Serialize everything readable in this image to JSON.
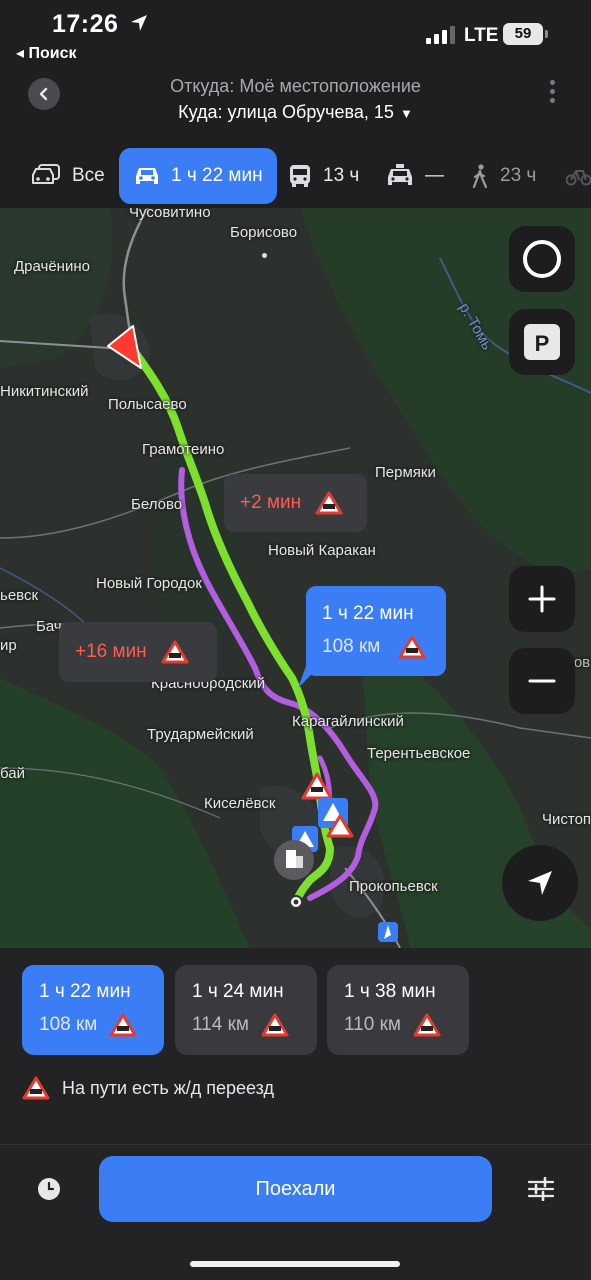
{
  "status_bar": {
    "time": "17:26",
    "back_app": "◂ Поиск",
    "network": "LTE",
    "battery": "59"
  },
  "header": {
    "from": "Откуда: Моё местоположение",
    "to": "Куда: улица Обручева, 15"
  },
  "modes": [
    {
      "label": "Все",
      "icon": "all-transport-icon"
    },
    {
      "label": "1 ч 22 мин",
      "icon": "car-icon",
      "active": true
    },
    {
      "label": "13 ч",
      "icon": "bus-icon"
    },
    {
      "label": "—",
      "icon": "taxi-icon"
    },
    {
      "label": "23 ч",
      "icon": "pedestrian-icon"
    }
  ],
  "map": {
    "places": {
      "chusovitino": "Чусовитино",
      "borisovo": "Борисово",
      "drachenino": "Драчёнино",
      "tom_river": "р. Томь",
      "nikitinsky": "Никитинский",
      "polysaevo": "Полысаево",
      "gramoteino": "Грамотеино",
      "permyaki": "Пермяки",
      "belovo": "Белово",
      "novy_karakan": "Новый Каракан",
      "novy_gorodok": "Новый Городок",
      "pevsk": "ьевск",
      "bach": "Бач",
      "ir": "ир",
      "osinov": "Осинов",
      "krasnobrodsky": "Краснобродский",
      "trudarmeysky": "Трудармейский",
      "karagaylinsky": "Карагайлинский",
      "terentievskoe": "Терентьевское",
      "bai": "бай",
      "kiselevsk": "Киселёвск",
      "chistop": "Чистоп",
      "prokopievsk": "Прокопьевск"
    },
    "bubbles": {
      "alt1_delay": "+2 мин",
      "alt2_delay": "+16 мин",
      "main_time": "1 ч 22 мин",
      "main_dist": "108 км"
    },
    "colors": {
      "main_route": "#7ee02e",
      "alt_route": "#b35ee0",
      "accent": "#3a7df5",
      "warning_red": "#ff5b4f"
    }
  },
  "routes": [
    {
      "time": "1 ч 22 мин",
      "dist": "108 км",
      "active": true
    },
    {
      "time": "1 ч 24 мин",
      "dist": "114 км"
    },
    {
      "time": "1 ч 38 мин",
      "dist": "110 км"
    }
  ],
  "notice": "На пути есть ж/д переезд",
  "go_button": "Поехали"
}
